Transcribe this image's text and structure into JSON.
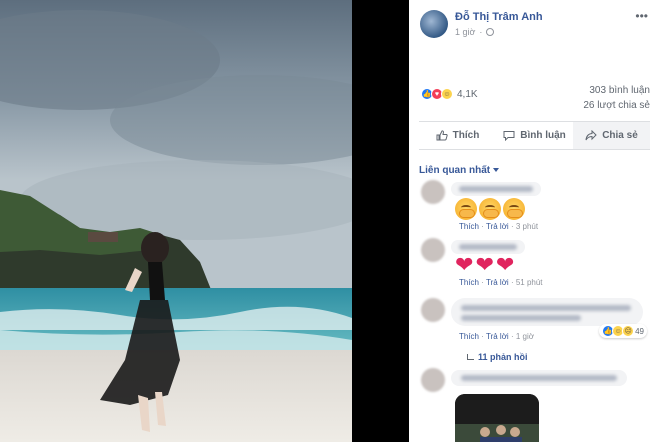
{
  "post": {
    "author": "Đỗ Thị Trâm Anh",
    "time": "1 giờ",
    "more_icon": "ellipsis-horizontal-icon",
    "privacy_icon": "globe-icon"
  },
  "stats": {
    "reaction_icons": [
      "like-icon",
      "love-icon",
      "haha-icon"
    ],
    "reaction_count": "4,1K",
    "comments": "303 bình luận",
    "shares": "26 lượt chia sẻ"
  },
  "actions": {
    "like": "Thích",
    "comment": "Bình luận",
    "share": "Chia sẻ"
  },
  "sort": {
    "label": "Liên quan nhất"
  },
  "comments": [
    {
      "emoji": "hug",
      "like": "Thích",
      "reply": "Trả lời",
      "time": "3 phút"
    },
    {
      "emoji": "heart",
      "like": "Thích",
      "reply": "Trả lời",
      "time": "51 phút"
    },
    {
      "like": "Thích",
      "reply": "Trả lời",
      "time": "1 giờ",
      "reaction_count": "49",
      "replies": "11 phản hồi"
    },
    {
      "note": "comment-with-image"
    }
  ],
  "colors": {
    "link": "#385898",
    "muted": "#90949c",
    "like_blue": "#2078f4",
    "love_red": "#f33e58",
    "bubble": "#f2f3f5"
  }
}
